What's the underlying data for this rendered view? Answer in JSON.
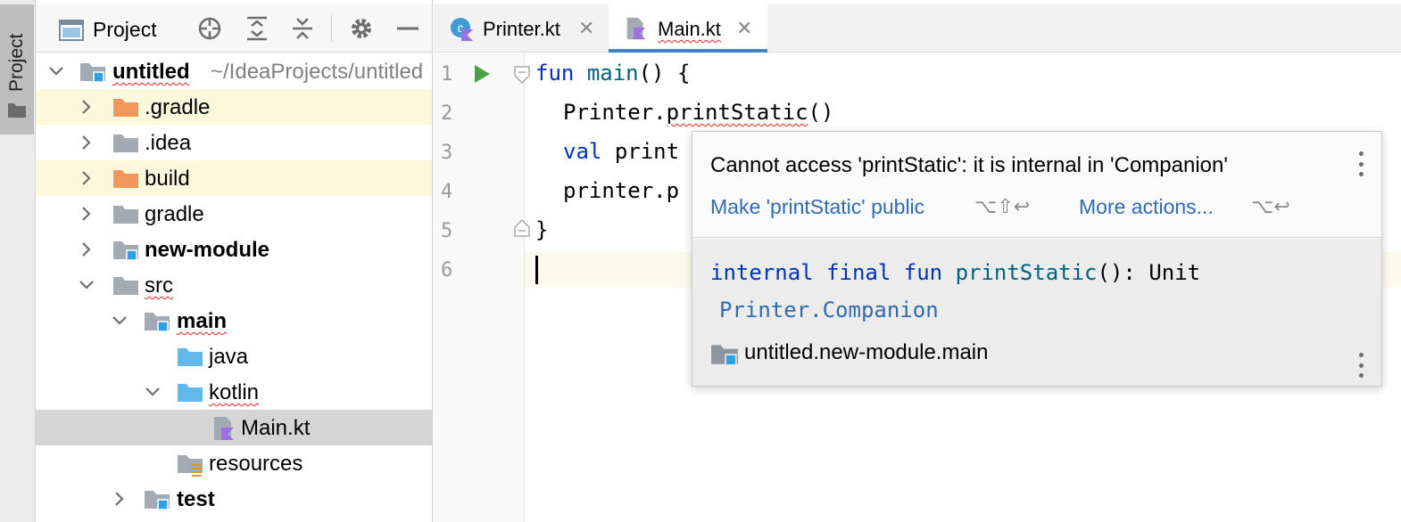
{
  "side_strip": {
    "label": "Project"
  },
  "project_panel": {
    "title": "Project",
    "icons": [
      "locate-icon",
      "expand-all-icon",
      "collapse-all-icon",
      "gear-icon",
      "minimize-icon"
    ]
  },
  "tree": {
    "root_name": "untitled",
    "root_path": "~/IdeaProjects/untitled",
    "items": [
      {
        "label": "untitled"
      },
      {
        "label": ".gradle"
      },
      {
        "label": ".idea"
      },
      {
        "label": "build"
      },
      {
        "label": "gradle"
      },
      {
        "label": "new-module"
      },
      {
        "label": "src"
      },
      {
        "label": "main"
      },
      {
        "label": "java"
      },
      {
        "label": "kotlin"
      },
      {
        "label": "Main.kt"
      },
      {
        "label": "resources"
      },
      {
        "label": "test"
      }
    ]
  },
  "tabs": [
    {
      "label": "Printer.kt",
      "active": false
    },
    {
      "label": "Main.kt",
      "active": true
    }
  ],
  "editor": {
    "line_numbers": [
      "1",
      "2",
      "3",
      "4",
      "5",
      "6"
    ],
    "lines": {
      "l1_kw": "fun",
      "l1_fn": "main",
      "l1_rest": "() {",
      "l2_a": "Printer.",
      "l2_b": "printStatic",
      "l2_c": "()",
      "l3_kw": "val",
      "l3_rest": "print",
      "l4": "printer.p",
      "l5": "}"
    }
  },
  "popup": {
    "message": "Cannot access 'printStatic': it is internal in 'Companion'",
    "action1": "Make 'printStatic' public",
    "action1_shortcut": "⌥⇧↩",
    "action2": "More actions...",
    "action2_shortcut": "⌥↩",
    "signature": {
      "kw1": "internal",
      "kw2": "final",
      "kw3": "fun",
      "name": "printStatic",
      "rest": "(): Unit"
    },
    "class": "Printer.Companion",
    "module": "untitled.new-module.main"
  },
  "colors": {
    "accent": "#4083c9",
    "keyword": "#0033b3",
    "function": "#00627a",
    "link": "#2f6bb3",
    "error_squiggle": "#e5221c",
    "excluded_bg": "#fbf8dc",
    "selected_bg": "#d5d5d5"
  }
}
